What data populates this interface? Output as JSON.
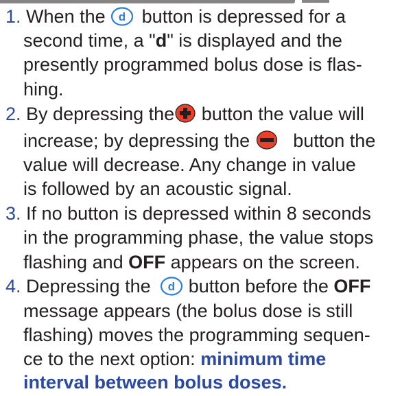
{
  "items": [
    {
      "number": "1.",
      "lines": {
        "l1a": "When the",
        "l1b": "button is depressed for a",
        "l2a": "second time, a \"",
        "l2b": "d",
        "l2c": "\" is displayed and the",
        "l3": "presently programmed bolus dose is flas-",
        "l4": "hing."
      }
    },
    {
      "number": "2.",
      "lines": {
        "l1a": "By depressing the",
        "l1b": "button the value will",
        "l2a": "increase; by depressing the",
        "l2b": "button the",
        "l3": "value will decrease. Any change in value",
        "l4": "is followed by an acoustic signal."
      }
    },
    {
      "number": "3.",
      "lines": {
        "l1": "If no button is depressed within 8 seconds",
        "l2": "in the programming phase, the value stops",
        "l3a": "flashing and",
        "l3b": "OFF",
        "l3c": "appears on the screen."
      }
    },
    {
      "number": "4.",
      "lines": {
        "l1a": "Depressing the",
        "l1b": "button before the",
        "l1c": "OFF",
        "l2": "message appears (the bolus dose is still",
        "l3": "flashing) moves the programming sequen-",
        "l4": "ce to the next option:",
        "l4b": "minimum time",
        "l5": "interval between bolus doses."
      }
    }
  ],
  "icons": {
    "d_button": {
      "name": "d-button-icon",
      "letter": "d",
      "ring": "#2b7fd6",
      "letter_color": "#2b7fd6"
    },
    "plus_button": {
      "name": "plus-button-icon",
      "fill": "#e8402a"
    },
    "minus_button": {
      "name": "minus-button-icon",
      "fill": "#e8402a"
    }
  },
  "colors": {
    "text": "#231f20",
    "numbers": "#2b4aa0",
    "emphasis": "#2b4aa0",
    "accent_red": "#e8402a",
    "accent_blue": "#2b7fd6"
  }
}
